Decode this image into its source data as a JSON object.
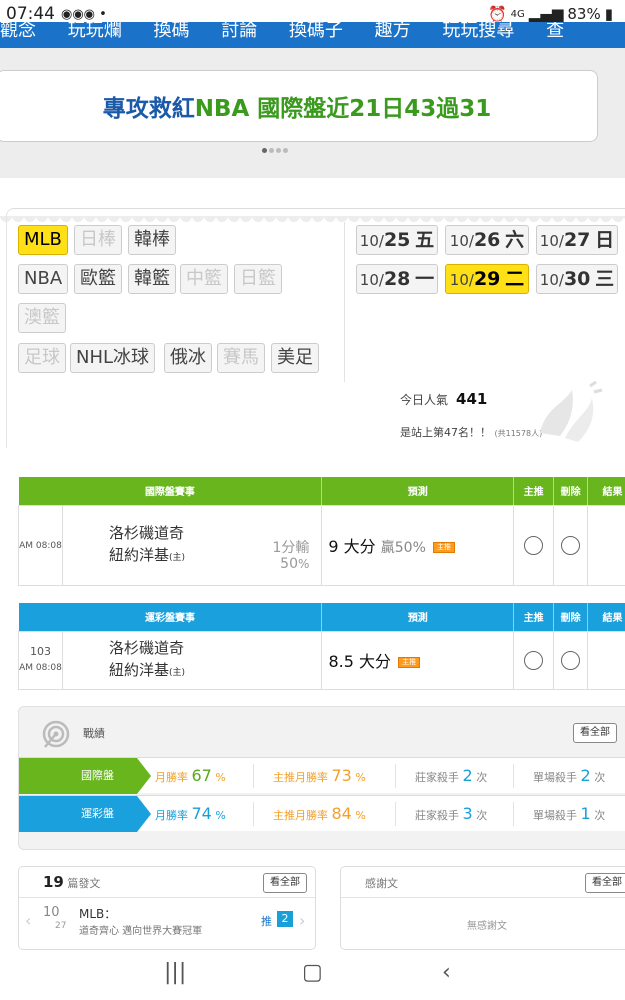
{
  "status": {
    "time": "07:44",
    "battery": "83%",
    "network": "4G"
  },
  "nav_strip": [
    "觀念",
    "玩玩爛",
    "換碼",
    "討論",
    "換碼子",
    "趣方",
    "玩玩搜尋",
    "查"
  ],
  "banner": {
    "part1": "專攻救紅 ",
    "part2": "NBA 國際盤近21日43過31"
  },
  "sports": {
    "row1": [
      "MLB",
      "日棒",
      "韓棒"
    ],
    "row2": [
      "NBA",
      "歐籃",
      "韓籃",
      "中籃",
      "日籃"
    ],
    "row3": [
      "澳籃"
    ],
    "row4": [
      "足球",
      "NHL冰球",
      "俄冰",
      "賽馬",
      "美足"
    ]
  },
  "dates": [
    {
      "md": "10/",
      "d": "25",
      "wd": "五"
    },
    {
      "md": "10/",
      "d": "26",
      "wd": "六"
    },
    {
      "md": "10/",
      "d": "27",
      "wd": "日"
    },
    {
      "md": "10/",
      "d": "28",
      "wd": "一"
    },
    {
      "md": "10/",
      "d": "29",
      "wd": "二"
    },
    {
      "md": "10/",
      "d": "30",
      "wd": "三"
    }
  ],
  "popularity": {
    "label": "今日人氣",
    "value": "441",
    "rank": "是站上第47名！！",
    "total": "(共11578人)"
  },
  "intl_table": {
    "headers": [
      "國際盤賽事",
      "預測",
      "主推",
      "刪除",
      "結果"
    ],
    "time": "AM 08:08",
    "team1": "洛杉磯道奇",
    "team2": "紐約洋基",
    "home_mark": "(主)",
    "odds_text": "1分輸",
    "odds_pct": "50",
    "pct_sign": "%",
    "prediction": "9 大分",
    "win_text": "贏50%",
    "tag": "主推"
  },
  "sport_table": {
    "headers": [
      "運彩盤賽事",
      "預測",
      "主推",
      "刪除",
      "結果"
    ],
    "number": "103",
    "time": "AM 08:08",
    "team1": "洛杉磯道奇",
    "team2": "紐約洋基",
    "home_mark": "(主)",
    "prediction": "8.5 大分",
    "tag": "主推"
  },
  "stats": {
    "title": "戰績",
    "view_all": "看全部",
    "intl": {
      "label": "國際盤",
      "month_label": "月勝率",
      "month": "67",
      "top_label": "主推月勝率",
      "top": "73",
      "killer_label": "莊家殺手",
      "killer": "2",
      "single_label": "單場殺手",
      "single": "2",
      "unit": "次",
      "pct": "%"
    },
    "sport": {
      "label": "運彩盤",
      "month_label": "月勝率",
      "month": "74",
      "top_label": "主推月勝率",
      "top": "84",
      "killer_label": "莊家殺手",
      "killer": "3",
      "single_label": "單場殺手",
      "single": "1",
      "unit": "次",
      "pct": "%"
    }
  },
  "posts": {
    "count": "19",
    "label": "篇發文",
    "view_all": "看全部",
    "page": "10",
    "of": "27",
    "item_title": "MLB：",
    "item_desc": "道奇齊心 邁向世界大賽冠軍",
    "push_label": "推",
    "push_count": "2"
  },
  "thanks": {
    "title": "感謝文",
    "view_all": "看全部",
    "empty": "無感謝文"
  },
  "colors": {
    "intl_green": "#68b51e",
    "sport_blue": "#1aa0dc",
    "selected_yellow": "#ffe017",
    "accent_orange": "#f3a02a"
  }
}
